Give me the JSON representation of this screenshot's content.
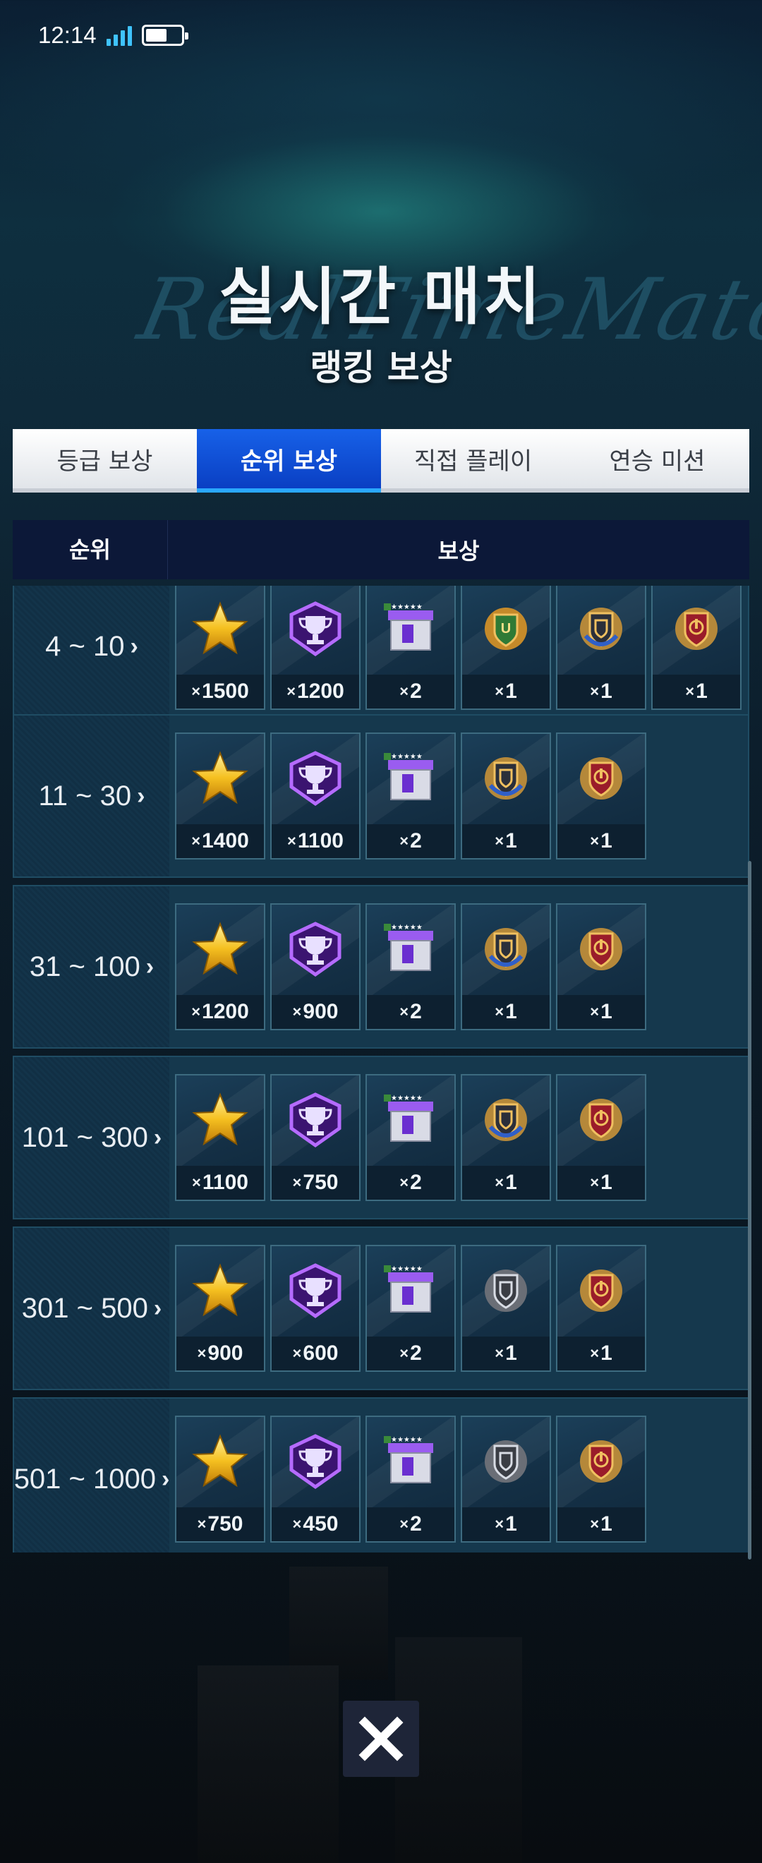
{
  "status_bar": {
    "time": "12:14"
  },
  "title": {
    "bg_text": "RealTimeMatchup",
    "main": "실시간 매치",
    "sub": "랭킹 보상"
  },
  "tabs": [
    {
      "label": "등급 보상",
      "active": false
    },
    {
      "label": "순위 보상",
      "active": true
    },
    {
      "label": "직접 플레이",
      "active": false
    },
    {
      "label": "연승 미션",
      "active": false
    }
  ],
  "table_header": {
    "rank": "순위",
    "reward": "보상"
  },
  "colors": {
    "accent": "#0a3fc3",
    "row_bg": "#15384d",
    "header_bg": "#0c1838"
  },
  "rows": [
    {
      "rank": "4 ~ 10",
      "chevron": "›",
      "rewards": [
        {
          "icon": "gold-star-icon",
          "qty": "1500"
        },
        {
          "icon": "purple-trophy-icon",
          "qty": "1200"
        },
        {
          "icon": "player-pack-box-icon",
          "qty": "2"
        },
        {
          "icon": "green-emblem-icon",
          "qty": "1"
        },
        {
          "icon": "blue-emblem-icon",
          "qty": "1"
        },
        {
          "icon": "red-emblem-icon",
          "qty": "1"
        }
      ]
    },
    {
      "rank": "11 ~ 30",
      "chevron": "›",
      "rewards": [
        {
          "icon": "gold-star-icon",
          "qty": "1400"
        },
        {
          "icon": "purple-trophy-icon",
          "qty": "1100"
        },
        {
          "icon": "player-pack-box-icon",
          "qty": "2"
        },
        {
          "icon": "blue-emblem-icon",
          "qty": "1"
        },
        {
          "icon": "red-emblem-icon",
          "qty": "1"
        }
      ]
    },
    {
      "rank": "31 ~ 100",
      "chevron": "›",
      "rewards": [
        {
          "icon": "gold-star-icon",
          "qty": "1200"
        },
        {
          "icon": "purple-trophy-icon",
          "qty": "900"
        },
        {
          "icon": "player-pack-box-icon",
          "qty": "2"
        },
        {
          "icon": "blue-emblem-icon",
          "qty": "1"
        },
        {
          "icon": "red-emblem-icon",
          "qty": "1"
        }
      ]
    },
    {
      "rank": "101 ~ 300",
      "chevron": "›",
      "rewards": [
        {
          "icon": "gold-star-icon",
          "qty": "1100"
        },
        {
          "icon": "purple-trophy-icon",
          "qty": "750"
        },
        {
          "icon": "player-pack-box-icon",
          "qty": "2"
        },
        {
          "icon": "blue-emblem-icon",
          "qty": "1"
        },
        {
          "icon": "red-emblem-icon",
          "qty": "1"
        }
      ]
    },
    {
      "rank": "301 ~ 500",
      "chevron": "›",
      "rewards": [
        {
          "icon": "gold-star-icon",
          "qty": "900"
        },
        {
          "icon": "purple-trophy-icon",
          "qty": "600"
        },
        {
          "icon": "player-pack-box-icon",
          "qty": "2"
        },
        {
          "icon": "silver-emblem-icon",
          "qty": "1"
        },
        {
          "icon": "red-emblem-icon",
          "qty": "1"
        }
      ]
    },
    {
      "rank": "501 ~ 1000",
      "chevron": "›",
      "rewards": [
        {
          "icon": "gold-star-icon",
          "qty": "750"
        },
        {
          "icon": "purple-trophy-icon",
          "qty": "450"
        },
        {
          "icon": "player-pack-box-icon",
          "qty": "2"
        },
        {
          "icon": "silver-emblem-icon",
          "qty": "1"
        },
        {
          "icon": "red-emblem-icon",
          "qty": "1"
        }
      ]
    }
  ],
  "close_button": {
    "icon": "close-icon"
  }
}
